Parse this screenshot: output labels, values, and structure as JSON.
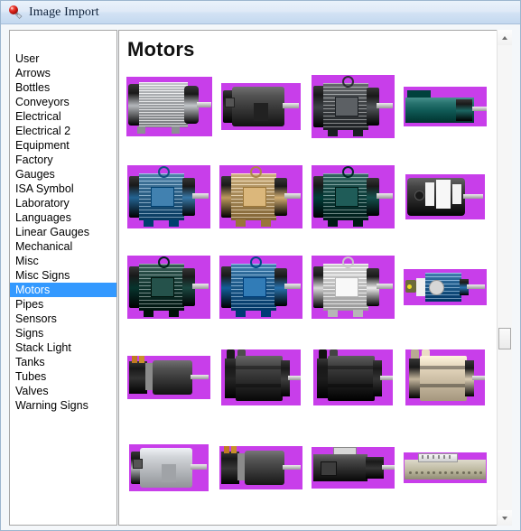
{
  "window": {
    "title": "Image Import",
    "icon": "image-import-icon"
  },
  "sidebar": {
    "name": "category-list",
    "selected": "Motors",
    "items": [
      {
        "label": "User",
        "selected": false
      },
      {
        "label": "Arrows",
        "selected": false
      },
      {
        "label": "Bottles",
        "selected": false
      },
      {
        "label": "Conveyors",
        "selected": false
      },
      {
        "label": "Electrical",
        "selected": false
      },
      {
        "label": "Electrical 2",
        "selected": false
      },
      {
        "label": "Equipment",
        "selected": false
      },
      {
        "label": "Factory",
        "selected": false
      },
      {
        "label": "Gauges",
        "selected": false
      },
      {
        "label": "ISA Symbol",
        "selected": false
      },
      {
        "label": "Laboratory",
        "selected": false
      },
      {
        "label": "Languages",
        "selected": false
      },
      {
        "label": "Linear Gauges",
        "selected": false
      },
      {
        "label": "Mechanical",
        "selected": false
      },
      {
        "label": "Misc",
        "selected": false
      },
      {
        "label": "Misc Signs",
        "selected": false
      },
      {
        "label": "Motors",
        "selected": true
      },
      {
        "label": "Pipes",
        "selected": false
      },
      {
        "label": "Sensors",
        "selected": false
      },
      {
        "label": "Signs",
        "selected": false
      },
      {
        "label": "Stack Light",
        "selected": false
      },
      {
        "label": "Tanks",
        "selected": false
      },
      {
        "label": "Tubes",
        "selected": false
      },
      {
        "label": "Valves",
        "selected": false
      },
      {
        "label": "Warning Signs",
        "selected": false
      }
    ]
  },
  "content": {
    "heading": "Motors",
    "transparency_key_color": "#c83eea",
    "thumbnails": [
      {
        "name": "motor-silver-finned",
        "style": "finned-horizontal",
        "color": "#b9bcc0"
      },
      {
        "name": "motor-black-compact",
        "style": "drum",
        "color": "#3a3a3a"
      },
      {
        "name": "motor-dark-grey-industrial",
        "style": "industrial",
        "color": "#4a4e52"
      },
      {
        "name": "motor-teal-block",
        "style": "block",
        "color": "#0f5a56"
      },
      {
        "name": "motor-blue-industrial",
        "style": "industrial",
        "color": "#2f6f9e"
      },
      {
        "name": "motor-tan-industrial",
        "style": "industrial",
        "color": "#c9a569"
      },
      {
        "name": "motor-dark-teal-industrial",
        "style": "industrial",
        "color": "#0d4a46"
      },
      {
        "name": "motor-black-labeled-drum",
        "style": "drum-labels",
        "color": "#2c2c2c"
      },
      {
        "name": "motor-green-industrial",
        "style": "industrial",
        "color": "#134039"
      },
      {
        "name": "motor-blue-finned",
        "style": "industrial",
        "color": "#1f6aa5"
      },
      {
        "name": "motor-white-industrial",
        "style": "industrial",
        "color": "#e6e6e6"
      },
      {
        "name": "motor-blue-gearbox",
        "style": "gearmotor",
        "color": "#1f6aa5"
      },
      {
        "name": "motor-servo-black-terminal",
        "style": "servo-terminal",
        "color": "#3a3a3a"
      },
      {
        "name": "motor-servo-black-a",
        "style": "servo",
        "color": "#2f2f2f"
      },
      {
        "name": "motor-servo-black-b",
        "style": "servo",
        "color": "#262626"
      },
      {
        "name": "motor-servo-beige",
        "style": "servo",
        "color": "#cdbfa6"
      },
      {
        "name": "motor-silver-smooth",
        "style": "drum",
        "color": "#b9bcc0"
      },
      {
        "name": "motor-dark-gearmotor",
        "style": "servo-terminal",
        "color": "#3f3f3f"
      },
      {
        "name": "motor-black-linear",
        "style": "linear-drive",
        "color": "#2f2f2f"
      },
      {
        "name": "linear-actuator-rail",
        "style": "rail",
        "color": "#b8b49a"
      }
    ]
  },
  "scrollbar": {
    "name": "content-scrollbar",
    "up_icon": "chevron-up-icon",
    "down_icon": "chevron-down-icon",
    "thumb": "scrollbar-thumb"
  }
}
